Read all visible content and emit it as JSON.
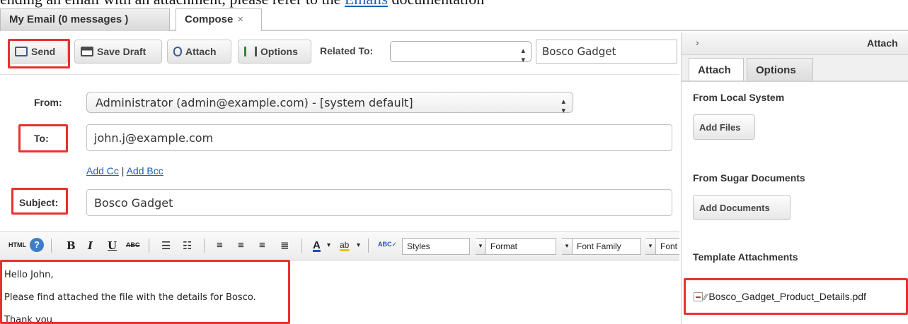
{
  "doc_text": {
    "before_link": "ending an email with an attachment, please refer to the ",
    "link": "Emails",
    "after_link": " documentation"
  },
  "tabs": [
    {
      "label": "My Email (0 messages )"
    },
    {
      "label": "Compose",
      "close": "×"
    }
  ],
  "toolbar": {
    "send": "Send",
    "save_draft": "Save Draft",
    "attach": "Attach",
    "options": "Options",
    "related_to_label": "Related To:",
    "related_to_select": "",
    "related_to_value": "Bosco Gadget"
  },
  "form": {
    "from_label": "From:",
    "from_value": "Administrator (admin@example.com) - [system default]",
    "to_label": "To:",
    "to_value": "john.j@example.com",
    "add_cc": "Add Cc",
    "cc_sep": " | ",
    "add_bcc": "Add Bcc",
    "subject_label": "Subject:",
    "subject_value": "Bosco Gadget"
  },
  "editor_toolbar": {
    "html": "HTML",
    "bold": "B",
    "italic": "I",
    "underline": "U",
    "strike": "ABC",
    "styles": "Styles",
    "format": "Format",
    "font_family": "Font Family",
    "font_size": "Font"
  },
  "editor_body": {
    "line1": "Hello John,",
    "line2": "Please find attached the file with the details for Bosco.",
    "line3": "Thank you"
  },
  "right_panel": {
    "title": "Attach",
    "tabs": [
      "Attach",
      "Options"
    ],
    "local_heading": "From Local System",
    "add_files": "Add Files",
    "sugar_heading": "From Sugar Documents",
    "add_documents": "Add Documents",
    "template_heading": "Template Attachments",
    "attachment_file": "Bosco_Gadget_Product_Details.pdf"
  },
  "colors": {
    "highlight": "#e8322c",
    "link": "#1a5fb4"
  }
}
